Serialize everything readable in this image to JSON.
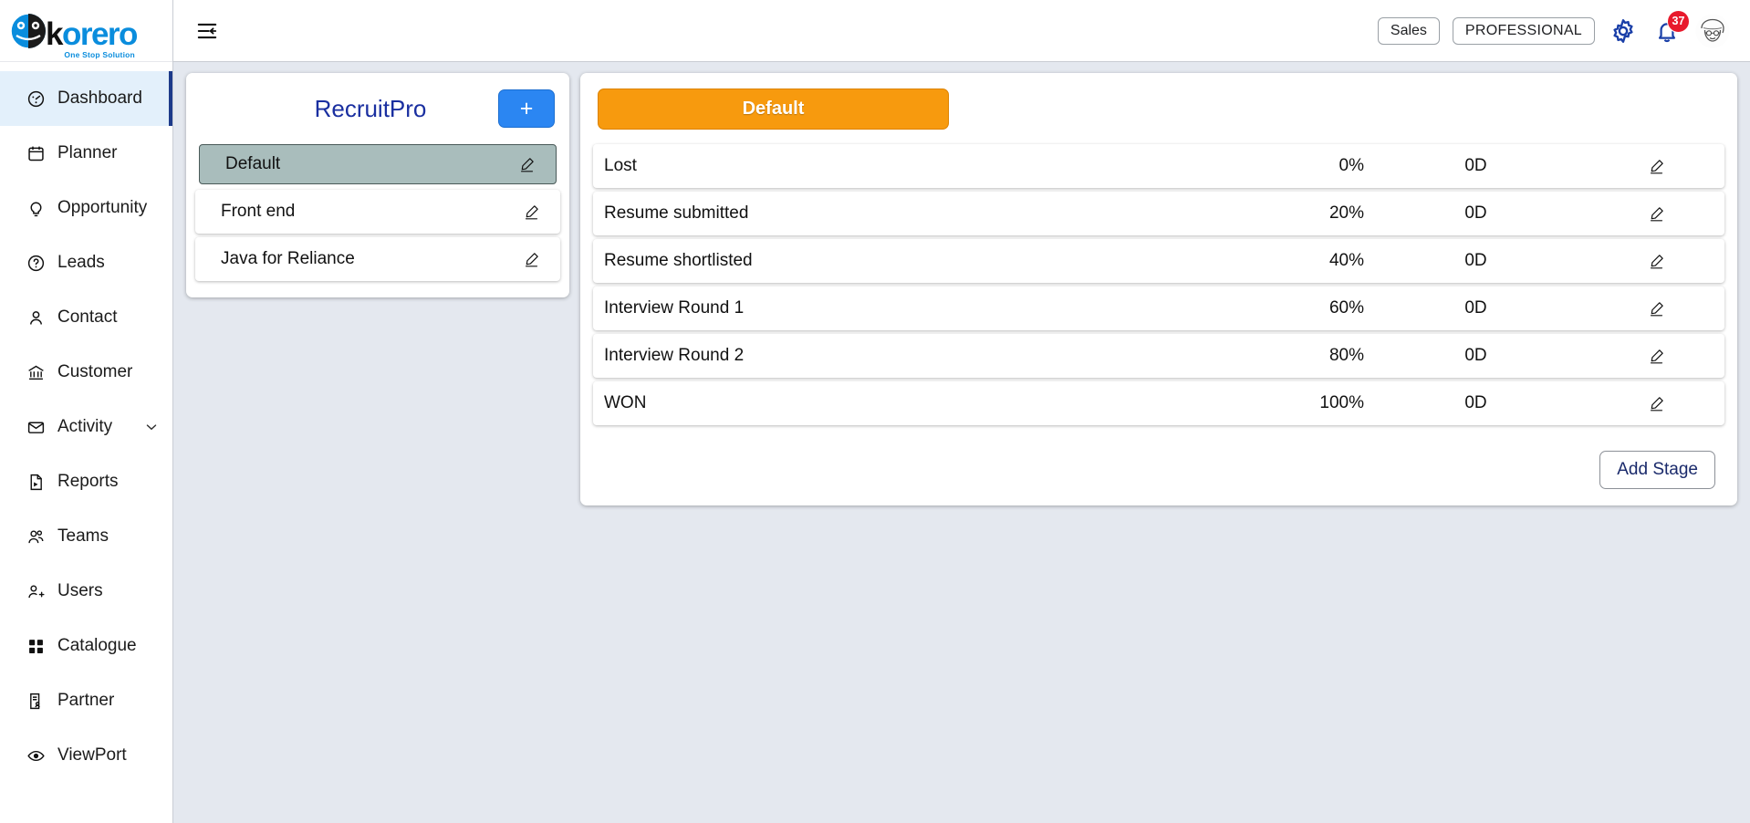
{
  "brand": {
    "name_part1": "k",
    "name_part2": "orero",
    "tagline": "One Stop Solution",
    "logo_icon": "korero-globe-icon",
    "accent_blue": "#0a8ddd"
  },
  "sidebar": {
    "items": [
      {
        "label": "Dashboard",
        "icon": "speedometer-icon",
        "active": true
      },
      {
        "label": "Planner",
        "icon": "calendar-icon",
        "active": false
      },
      {
        "label": "Opportunity",
        "icon": "lightbulb-icon",
        "active": false
      },
      {
        "label": "Leads",
        "icon": "question-circle-icon",
        "active": false
      },
      {
        "label": "Contact",
        "icon": "person-icon",
        "active": false
      },
      {
        "label": "Customer",
        "icon": "bank-icon",
        "active": false
      },
      {
        "label": "Activity",
        "icon": "envelope-icon",
        "active": false,
        "chevron": "chevron-down-icon"
      },
      {
        "label": "Reports",
        "icon": "file-chart-icon",
        "active": false
      },
      {
        "label": "Teams",
        "icon": "people-icon",
        "active": false
      },
      {
        "label": "Users",
        "icon": "person-add-icon",
        "active": false
      },
      {
        "label": "Catalogue",
        "icon": "grid-icon",
        "active": false
      },
      {
        "label": "Partner",
        "icon": "document-person-icon",
        "active": false
      },
      {
        "label": "ViewPort",
        "icon": "eye-icon",
        "active": false
      }
    ]
  },
  "topbar": {
    "collapse_icon": "collapse-sidebar-icon",
    "module_label": "Sales",
    "plan_label": "PROFESSIONAL",
    "settings_icon": "gear-icon",
    "notifications_icon": "bell-icon",
    "notifications_count": "37",
    "avatar_icon": "user-avatar"
  },
  "pipeline_panel": {
    "title": "RecruitPro",
    "add_label": "+",
    "edit_icon": "pencil-icon",
    "items": [
      {
        "label": "Default",
        "selected": true
      },
      {
        "label": "Front end",
        "selected": false
      },
      {
        "label": "Java for Reliance",
        "selected": false
      }
    ]
  },
  "stage_panel": {
    "active_tab": "Default",
    "edit_icon": "pencil-icon",
    "add_stage_label": "Add Stage",
    "rows": [
      {
        "name": "Lost",
        "percent": "0%",
        "duration": "0D"
      },
      {
        "name": "Resume submitted",
        "percent": "20%",
        "duration": "0D"
      },
      {
        "name": "Resume shortlisted",
        "percent": "40%",
        "duration": "0D"
      },
      {
        "name": "Interview Round 1",
        "percent": "60%",
        "duration": "0D"
      },
      {
        "name": "Interview Round 2",
        "percent": "80%",
        "duration": "0D"
      },
      {
        "name": "WON",
        "percent": "100%",
        "duration": "0D"
      }
    ]
  },
  "colors": {
    "accent_orange": "#f79a0e",
    "accent_blue": "#2b86f2",
    "selected_row": "#a9bdbc",
    "active_nav": "#e3f0fb",
    "badge_red": "#e8192c",
    "title_blue": "#1a2fa0"
  }
}
